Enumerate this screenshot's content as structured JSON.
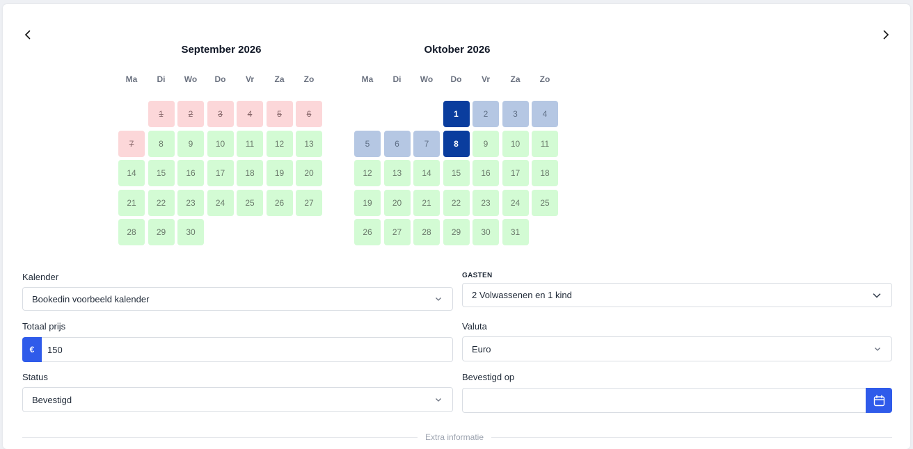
{
  "calendars": [
    {
      "title": "September 2026",
      "weekdays": [
        "Ma",
        "Di",
        "Wo",
        "Do",
        "Vr",
        "Za",
        "Zo"
      ],
      "first_weekday_index": 1,
      "days": [
        {
          "n": "1",
          "state": "booked"
        },
        {
          "n": "2",
          "state": "booked"
        },
        {
          "n": "3",
          "state": "booked"
        },
        {
          "n": "4",
          "state": "booked"
        },
        {
          "n": "5",
          "state": "booked"
        },
        {
          "n": "6",
          "state": "booked"
        },
        {
          "n": "7",
          "state": "booked"
        },
        {
          "n": "8",
          "state": "free"
        },
        {
          "n": "9",
          "state": "free"
        },
        {
          "n": "10",
          "state": "free"
        },
        {
          "n": "11",
          "state": "free"
        },
        {
          "n": "12",
          "state": "free"
        },
        {
          "n": "13",
          "state": "free"
        },
        {
          "n": "14",
          "state": "free"
        },
        {
          "n": "15",
          "state": "free"
        },
        {
          "n": "16",
          "state": "free"
        },
        {
          "n": "17",
          "state": "free"
        },
        {
          "n": "18",
          "state": "free"
        },
        {
          "n": "19",
          "state": "free"
        },
        {
          "n": "20",
          "state": "free"
        },
        {
          "n": "21",
          "state": "free"
        },
        {
          "n": "22",
          "state": "free"
        },
        {
          "n": "23",
          "state": "free"
        },
        {
          "n": "24",
          "state": "free"
        },
        {
          "n": "25",
          "state": "free"
        },
        {
          "n": "26",
          "state": "free"
        },
        {
          "n": "27",
          "state": "free"
        },
        {
          "n": "28",
          "state": "free"
        },
        {
          "n": "29",
          "state": "free"
        },
        {
          "n": "30",
          "state": "free"
        }
      ]
    },
    {
      "title": "Oktober 2026",
      "weekdays": [
        "Ma",
        "Di",
        "Wo",
        "Do",
        "Vr",
        "Za",
        "Zo"
      ],
      "first_weekday_index": 3,
      "days": [
        {
          "n": "1",
          "state": "selected"
        },
        {
          "n": "2",
          "state": "range"
        },
        {
          "n": "3",
          "state": "range"
        },
        {
          "n": "4",
          "state": "range"
        },
        {
          "n": "5",
          "state": "range"
        },
        {
          "n": "6",
          "state": "range"
        },
        {
          "n": "7",
          "state": "range"
        },
        {
          "n": "8",
          "state": "selected"
        },
        {
          "n": "9",
          "state": "free"
        },
        {
          "n": "10",
          "state": "free"
        },
        {
          "n": "11",
          "state": "free"
        },
        {
          "n": "12",
          "state": "free"
        },
        {
          "n": "13",
          "state": "free"
        },
        {
          "n": "14",
          "state": "free"
        },
        {
          "n": "15",
          "state": "free"
        },
        {
          "n": "16",
          "state": "free"
        },
        {
          "n": "17",
          "state": "free"
        },
        {
          "n": "18",
          "state": "free"
        },
        {
          "n": "19",
          "state": "free"
        },
        {
          "n": "20",
          "state": "free"
        },
        {
          "n": "21",
          "state": "free"
        },
        {
          "n": "22",
          "state": "free"
        },
        {
          "n": "23",
          "state": "free"
        },
        {
          "n": "24",
          "state": "free"
        },
        {
          "n": "25",
          "state": "free"
        },
        {
          "n": "26",
          "state": "free"
        },
        {
          "n": "27",
          "state": "free"
        },
        {
          "n": "28",
          "state": "free"
        },
        {
          "n": "29",
          "state": "free"
        },
        {
          "n": "30",
          "state": "free"
        },
        {
          "n": "31",
          "state": "free"
        }
      ]
    }
  ],
  "form": {
    "kalender": {
      "label": "Kalender",
      "value": "Bookedin voorbeeld kalender"
    },
    "gasten": {
      "label": "GASTEN",
      "value": "2 Volwassenen en 1 kind"
    },
    "totaal_prijs": {
      "label": "Totaal prijs",
      "currency_symbol": "€",
      "value": "150"
    },
    "valuta": {
      "label": "Valuta",
      "value": "Euro"
    },
    "status": {
      "label": "Status",
      "value": "Bevestigd"
    },
    "bevestigd_op": {
      "label": "Bevestigd op",
      "value": ""
    }
  },
  "divider_label": "Extra informatie",
  "icons": {
    "prev": "chevron-left-icon",
    "next": "chevron-right-icon",
    "select": "chevron-down-icon",
    "date": "calendar-icon"
  },
  "colors": {
    "booked": "#fcd7d9",
    "free": "#d3fbd4",
    "range": "#b5c7e3",
    "selected": "#0a3d9e",
    "accent": "#2f5bea"
  }
}
